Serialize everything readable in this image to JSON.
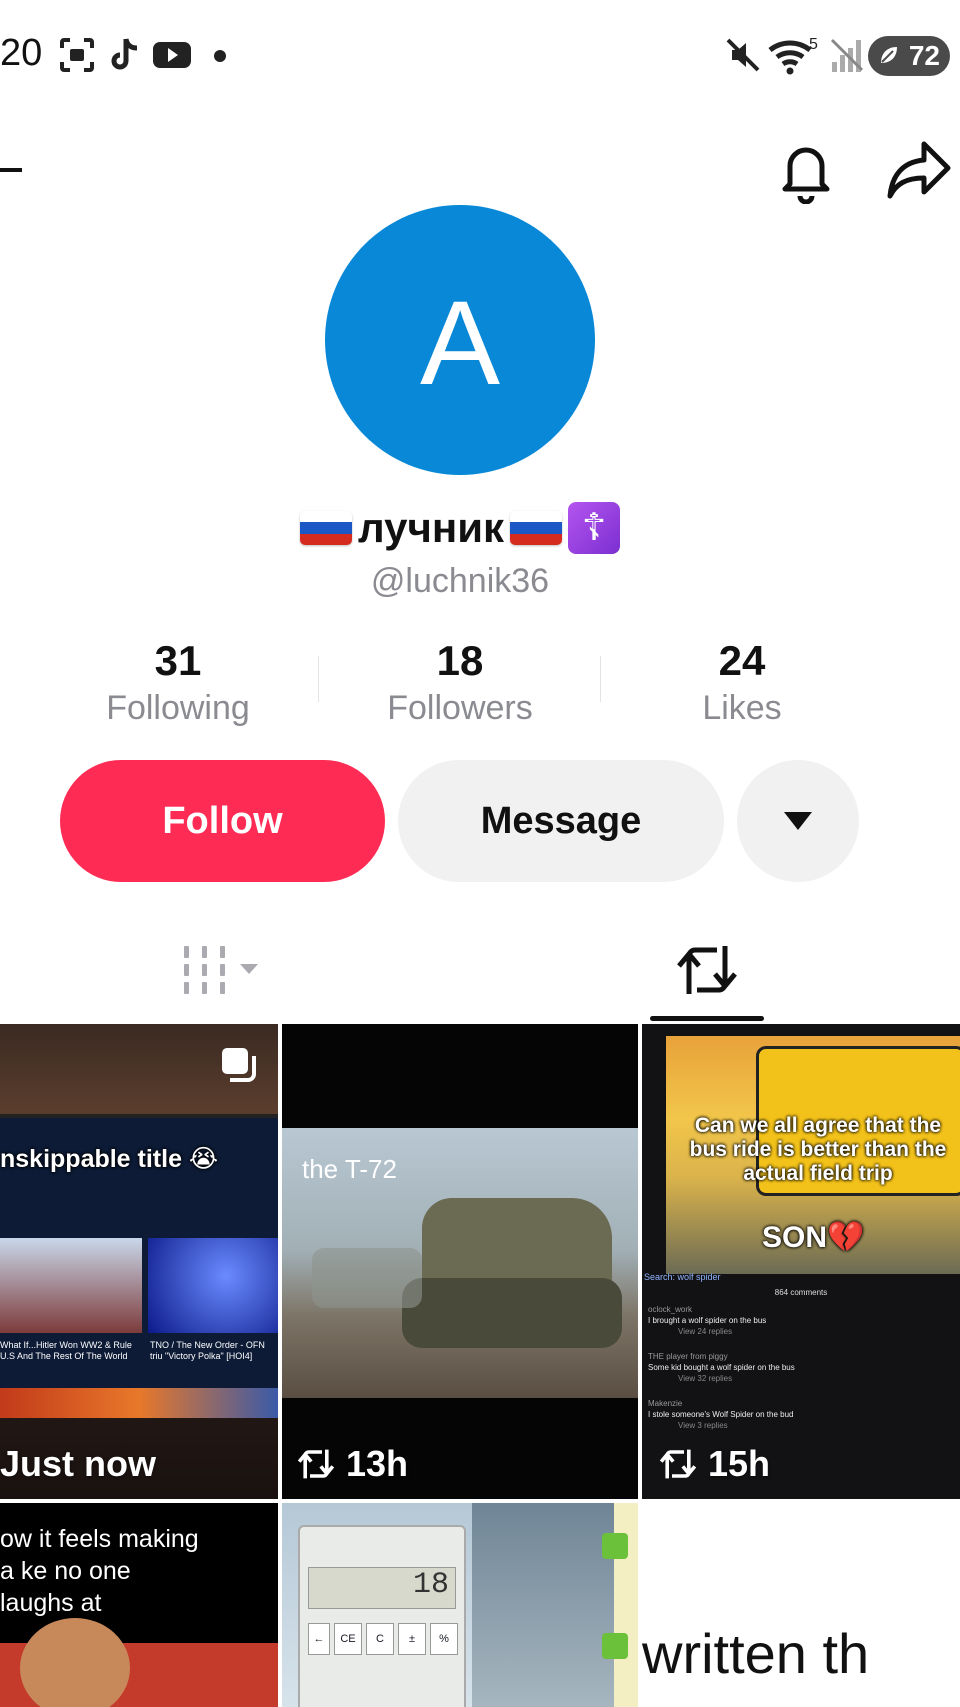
{
  "status_bar": {
    "time": "20",
    "battery": "72",
    "wifi_level": "5",
    "icons": [
      "screenshot-icon",
      "tiktok-icon",
      "youtube-icon",
      "dot-icon",
      "mute-icon",
      "wifi-icon",
      "no-signal-icon",
      "battery-icon"
    ]
  },
  "profile": {
    "avatar_letter": "A",
    "avatar_color": "#0888d6",
    "display_name": "лучник",
    "username": "@luchnik36"
  },
  "stats": {
    "following": {
      "count": "31",
      "label": "Following"
    },
    "followers": {
      "count": "18",
      "label": "Followers"
    },
    "likes": {
      "count": "24",
      "label": "Likes"
    }
  },
  "actions": {
    "follow": "Follow",
    "message": "Message"
  },
  "colors": {
    "follow": "#fe2c55",
    "secondary_button": "#f1f1f2"
  },
  "grid": {
    "tiles": [
      {
        "caption": "nskippable title 😭",
        "meta": "Just now",
        "pinned_icon": "multi-photo-icon",
        "sub_left": "What If...Hitler Won WW2 & Rule U.S And The Rest Of The World",
        "sub_right": "TNO / The New Order - OFN triu \"Victory Polka\" [HOI4]"
      },
      {
        "caption": "the T-72",
        "meta": "13h"
      },
      {
        "caption": "Can we all agree that the bus ride is better than the actual field trip",
        "caption2": "SON💔",
        "meta": "15h",
        "search": "Search: wolf spider",
        "comments_count": "864 comments",
        "comments": [
          {
            "user": "oclock_work",
            "text": "I brought a wolf spider on the bus",
            "replies": "View 24 replies"
          },
          {
            "user": "THE player from piggy",
            "text": "Some kid bought a wolf spider on the bus",
            "replies": "View 32 replies"
          },
          {
            "user": "Makenzie",
            "text": "I stole someone's Wolf Spider on the bud",
            "replies": "View 3 replies"
          }
        ]
      },
      {
        "caption": "ow it feels making a ke no one laughs at"
      },
      {
        "caption": "18",
        "calc_keys": [
          "CE",
          "C",
          "±",
          "%"
        ]
      },
      {
        "caption": "written th"
      }
    ]
  }
}
